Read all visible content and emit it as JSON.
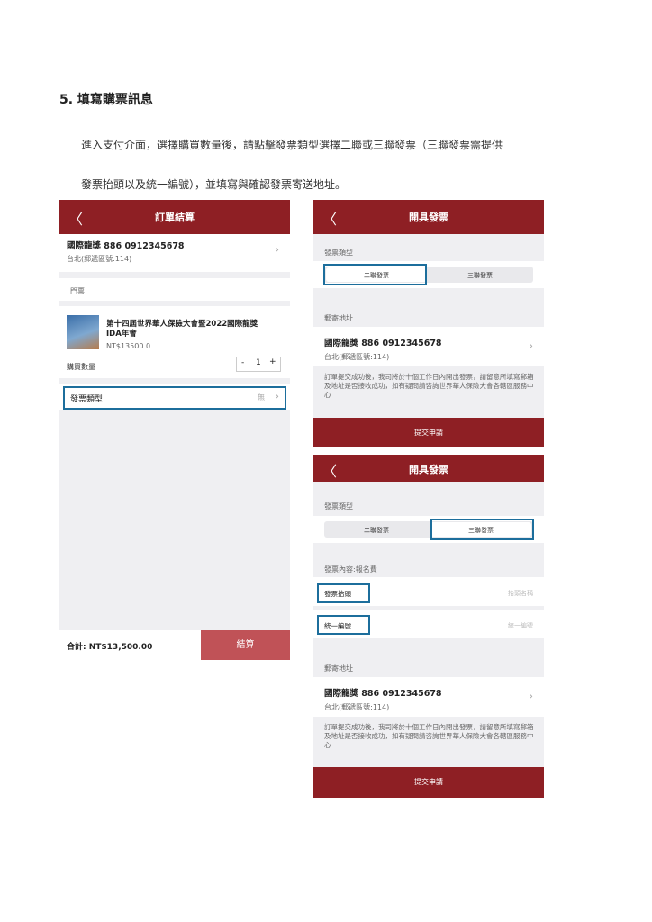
{
  "heading": "5.  填寫購票訊息",
  "paragraph": {
    "line1": "進入支付介面，選擇購買數量後，請點擊發票類型選擇二聯或三聯發票（三聯發票需提供",
    "line2": "發票抬頭以及統一編號），並填寫與確認發票寄送地址。"
  },
  "checkout": {
    "back": "〈",
    "title": "訂單結算",
    "name": "國際龍獎  886 0912345678",
    "address": "台北(郵遞區號:114)",
    "section_ticket": "門票",
    "product_title_line1": "第十四屆世界華人保險大會暨2022國際龍獎",
    "product_title_line2": "IDA年會",
    "price": "NT$13500.0",
    "qty_label": "購買數量",
    "qty_minus": "-",
    "qty_value": "1",
    "qty_plus": "+",
    "invoice_type_label": "發票類型",
    "invoice_type_value": "無",
    "total": "合計: NT$13,500.00",
    "pay_button": "結算"
  },
  "invoice1": {
    "back": "〈",
    "title": "開具發票",
    "type_label": "發票類型",
    "option_two": "二聯發票",
    "option_three": "三聯發票",
    "mail_label": "郵寄地址",
    "name": "國際龍獎  886 0912345678",
    "address": "台北(郵遞區號:114)",
    "note": "訂單提交成功後，我司將於十個工作日內開出發票，請留意所填寫郵箱及地址是否接收成功，如有疑問請咨詢世界華人保險大會各轄區服務中心",
    "submit": "提交申請"
  },
  "invoice2": {
    "back": "〈",
    "title": "開具發票",
    "type_label": "發票類型",
    "option_two": "二聯發票",
    "option_three": "三聯發票",
    "content_label": "發票內容:報名費",
    "title_field_label": "發票抬頭",
    "title_field_placeholder": "抬頭名稱",
    "tax_id_label": "統一編號",
    "tax_id_placeholder": "統一編號",
    "mail_label": "郵寄地址",
    "name": "國際龍獎  886 0912345678",
    "address": "台北(郵遞區號:114)",
    "note": "訂單提交成功後，我司將於十個工作日內開出發票，請留意所填寫郵箱及地址是否接收成功，如有疑問請咨詢世界華人保險大會各轄區服務中心",
    "submit": "提交申請"
  },
  "icons": {
    "chevron": "chevron-right-icon",
    "back": "back-arrow-icon"
  },
  "colors": {
    "brand": "#8e1f24",
    "highlight": "#1c6e9c"
  }
}
